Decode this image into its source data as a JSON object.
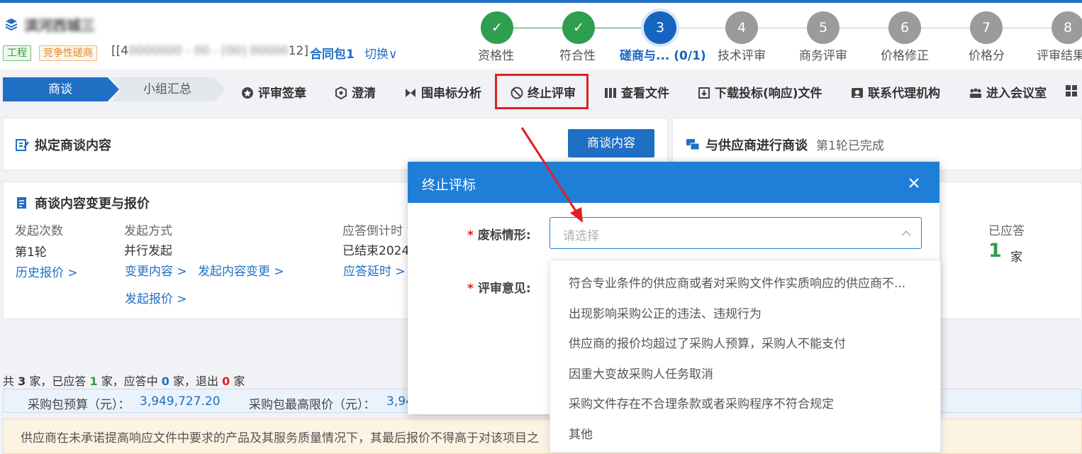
{
  "header": {
    "project_name": "滨河西城三",
    "tags": [
      "工程",
      "竞争性磋商"
    ],
    "project_code_prefix": "[[4",
    "project_code_blurred": "0000000 - 00 - [00] 00000",
    "project_code_suffix": "12]",
    "package": "合同包1",
    "switch": "切换∨"
  },
  "steps": [
    {
      "num": "✓",
      "label": "资格性",
      "state": "done"
    },
    {
      "num": "✓",
      "label": "符合性",
      "state": "done"
    },
    {
      "num": "3",
      "label": "磋商与... (0/1)",
      "state": "current"
    },
    {
      "num": "4",
      "label": "技术评审",
      "state": "todo"
    },
    {
      "num": "5",
      "label": "商务评审",
      "state": "todo"
    },
    {
      "num": "6",
      "label": "价格修正",
      "state": "todo"
    },
    {
      "num": "7",
      "label": "价格分",
      "state": "todo"
    },
    {
      "num": "8",
      "label": "评审结果",
      "state": "todo"
    }
  ],
  "toolbar": {
    "tab_active": "商谈",
    "tab_inactive": "小组汇总",
    "tools": [
      "评审签章",
      "澄清",
      "围串标分析",
      "终止评审",
      "查看文件",
      "下载投标(响应)文件",
      "联系代理机构",
      "进入会议室"
    ]
  },
  "card1": {
    "title": "拟定商谈内容",
    "button": "商谈内容"
  },
  "card2": {
    "title": "与供应商进行商谈",
    "status": "第1轮已完成"
  },
  "card3": {
    "title": "商谈内容变更与报价",
    "col1_label": "发起次数",
    "col1_value": "第1轮",
    "col1_link": "历史报价 >",
    "col2_label": "发起方式",
    "col2_value": "并行发起",
    "col2_links": [
      "变更内容 >",
      "发起内容变更 >",
      "发起报价 >"
    ],
    "col3_label": "应答倒计时",
    "col3_value": "已结束2024",
    "col3_link": "应答延时 >",
    "col4_label": "已应答",
    "col4_value": "1",
    "col4_unit": "家"
  },
  "summary": {
    "p1": "共",
    "total": "3",
    "p2": "家，已应答",
    "answered": "1",
    "p3": "家，应答中",
    "answering": "0",
    "p4": "家，退出",
    "exited": "0",
    "p5": "家"
  },
  "budget": {
    "label1": "采购包预算（元）：",
    "value1": "3,949,727.20",
    "label2": "采购包最高限价（元）：",
    "value2": "3,94"
  },
  "notice": "供应商在未承诺提高响应文件中要求的产品及其服务质量情况下，其最后报价不得高于对该项目之",
  "modal": {
    "title": "终止评标",
    "field1_label": "废标情形:",
    "field1_placeholder": "请选择",
    "field2_label": "评审意见:",
    "required_mark": "*"
  },
  "dropdown": {
    "options": [
      "符合专业条件的供应商或者对采购文件作实质响应的供应商不...",
      "出现影响采购公正的违法、违规行为",
      "供应商的报价均超过了采购人预算，采购人不能支付",
      "因重大变故采购人任务取消",
      "采购文件存在不合理条款或者采购程序不符合规定",
      "其他"
    ]
  },
  "colors": {
    "primary": "#1f6fc5",
    "modal_header": "#1f7fd8",
    "success": "#2e9e4f",
    "highlight": "#e02020"
  }
}
